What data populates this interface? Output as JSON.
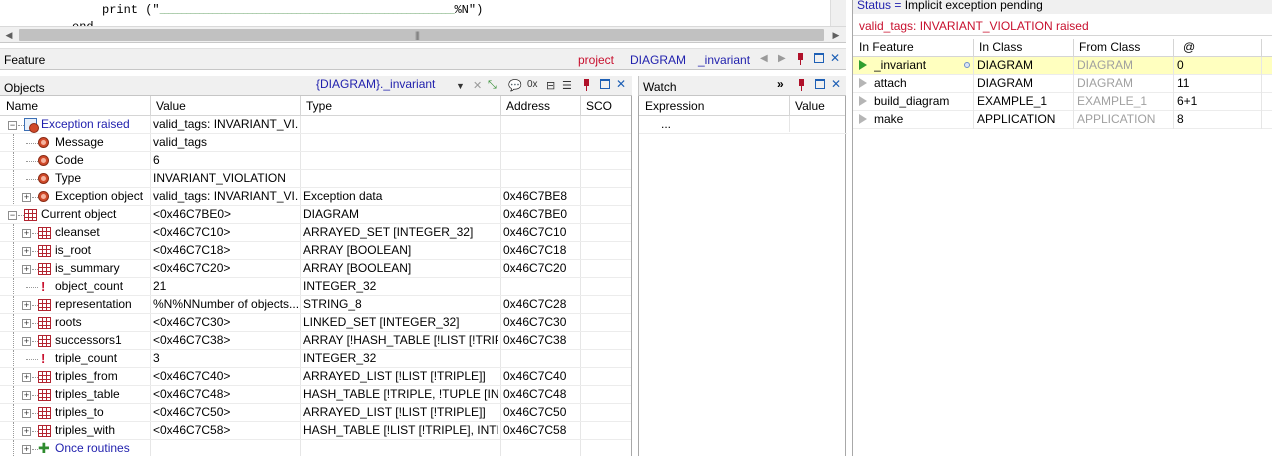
{
  "editor": {
    "line1_code": "print (\"",
    "line1_underscores": "___________________________________________________________________",
    "line1_end": "%N\")",
    "line2_code": "end"
  },
  "feature_panel": {
    "title": "Feature",
    "project_label": "project",
    "class_name": "DIAGRAM",
    "feature_name": "_invariant"
  },
  "objects_panel": {
    "title": "Objects",
    "context": "{DIAGRAM}._invariant",
    "counter": "0x",
    "columns": [
      "Name",
      "Value",
      "Type",
      "Address",
      "SCO"
    ],
    "rows": [
      {
        "name": "Exception raised",
        "value": "valid_tags: INVARIANT_VI...",
        "type": "",
        "address": "",
        "icon": "exception-doc-icon",
        "level": 0,
        "expander": "-",
        "name_color": "#1f1fad"
      },
      {
        "name": "Message",
        "value": "valid_tags",
        "type": "",
        "address": "",
        "icon": "exception-icon",
        "level": 1,
        "expander": ""
      },
      {
        "name": "Code",
        "value": "6",
        "type": "",
        "address": "",
        "icon": "exception-icon",
        "level": 1,
        "expander": ""
      },
      {
        "name": "Type",
        "value": "INVARIANT_VIOLATION",
        "type": "",
        "address": "",
        "icon": "exception-icon",
        "level": 1,
        "expander": ""
      },
      {
        "name": "Exception object",
        "value": "valid_tags: INVARIANT_VI...",
        "type": "Exception data",
        "address": "0x46C7BE8",
        "icon": "exception-icon",
        "level": 1,
        "expander": "+"
      },
      {
        "name": "Current object",
        "value": "<0x46C7BE0>",
        "type": "DIAGRAM",
        "address": "0x46C7BE0",
        "icon": "object-grid-icon",
        "level": 0,
        "expander": "-"
      },
      {
        "name": "cleanset",
        "value": "<0x46C7C10>",
        "type": "ARRAYED_SET [INTEGER_32]",
        "address": "0x46C7C10",
        "icon": "object-grid-icon",
        "level": 1,
        "expander": "+"
      },
      {
        "name": "is_root",
        "value": "<0x46C7C18>",
        "type": "ARRAY [BOOLEAN]",
        "address": "0x46C7C18",
        "icon": "object-grid-icon",
        "level": 1,
        "expander": "+"
      },
      {
        "name": "is_summary",
        "value": "<0x46C7C20>",
        "type": "ARRAY [BOOLEAN]",
        "address": "0x46C7C20",
        "icon": "object-grid-icon",
        "level": 1,
        "expander": "+"
      },
      {
        "name": "object_count",
        "value": "21",
        "type": "INTEGER_32",
        "address": "",
        "icon": "expanded-value-icon",
        "level": 1,
        "expander": ""
      },
      {
        "name": "representation",
        "value": "%N%NNumber of objects...",
        "type": "STRING_8",
        "address": "0x46C7C28",
        "icon": "object-grid-icon",
        "level": 1,
        "expander": "+"
      },
      {
        "name": "roots",
        "value": "<0x46C7C30>",
        "type": "LINKED_SET [INTEGER_32]",
        "address": "0x46C7C30",
        "icon": "object-grid-icon",
        "level": 1,
        "expander": "+"
      },
      {
        "name": "successors1",
        "value": "<0x46C7C38>",
        "type": "ARRAY [!HASH_TABLE [!LIST [!TRIP...",
        "address": "0x46C7C38",
        "icon": "object-grid-icon",
        "level": 1,
        "expander": "+"
      },
      {
        "name": "triple_count",
        "value": "3",
        "type": "INTEGER_32",
        "address": "",
        "icon": "expanded-value-icon",
        "level": 1,
        "expander": ""
      },
      {
        "name": "triples_from",
        "value": "<0x46C7C40>",
        "type": "ARRAYED_LIST [!LIST [!TRIPLE]]",
        "address": "0x46C7C40",
        "icon": "object-grid-icon",
        "level": 1,
        "expander": "+"
      },
      {
        "name": "triples_table",
        "value": "<0x46C7C48>",
        "type": "HASH_TABLE [!TRIPLE, !TUPLE [INT...",
        "address": "0x46C7C48",
        "icon": "object-grid-icon",
        "level": 1,
        "expander": "+"
      },
      {
        "name": "triples_to",
        "value": "<0x46C7C50>",
        "type": "ARRAYED_LIST [!LIST [!TRIPLE]]",
        "address": "0x46C7C50",
        "icon": "object-grid-icon",
        "level": 1,
        "expander": "+"
      },
      {
        "name": "triples_with",
        "value": "<0x46C7C58>",
        "type": "HASH_TABLE [!LIST [!TRIPLE], INTE...",
        "address": "0x46C7C58",
        "icon": "object-grid-icon",
        "level": 1,
        "expander": "+"
      },
      {
        "name": "Once routines",
        "value": "",
        "type": "",
        "address": "",
        "icon": "once-routines-icon",
        "level": 1,
        "expander": "+",
        "name_color": "#1f1fad"
      }
    ]
  },
  "watch_panel": {
    "title": "Watch",
    "more": "»",
    "columns": [
      "Expression",
      "Value"
    ],
    "placeholder_row": "..."
  },
  "status_panel": {
    "status_label": "Status = ",
    "status_value": "Implicit exception pending",
    "message": "valid_tags: INVARIANT_VIOLATION raised",
    "columns": [
      "In Feature",
      "In Class",
      "From Class",
      "@"
    ],
    "frames": [
      {
        "feature": "_invariant",
        "in_class": "DIAGRAM",
        "from_class": "DIAGRAM",
        "at": "0",
        "current": true
      },
      {
        "feature": "attach",
        "in_class": "DIAGRAM",
        "from_class": "DIAGRAM",
        "at": "11",
        "current": false
      },
      {
        "feature": "build_diagram",
        "in_class": "EXAMPLE_1",
        "from_class": "EXAMPLE_1",
        "at": "6+1",
        "current": false
      },
      {
        "feature": "make",
        "in_class": "APPLICATION",
        "from_class": "APPLICATION",
        "at": "8",
        "current": false
      }
    ]
  },
  "colors": {
    "accent_blue": "#1f1fad",
    "error_red": "#c8102e",
    "selection_yellow": "#ffffbf"
  }
}
